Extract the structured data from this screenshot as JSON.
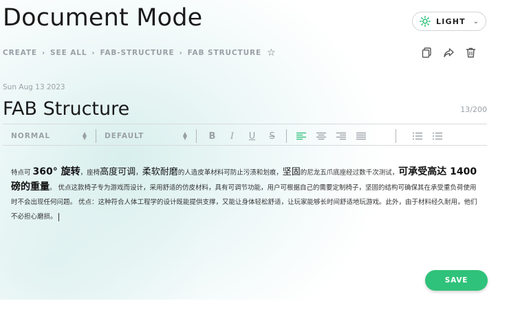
{
  "page": {
    "title": "Document Mode"
  },
  "theme": {
    "label": "LIGHT",
    "accent": "#2fc27a"
  },
  "breadcrumb": {
    "items": [
      "CREATE",
      "SEE ALL",
      "FAB-STRUCTURE",
      "FAB STRUCTURE"
    ]
  },
  "icons": {
    "copy": "copy-icon",
    "share": "share-icon",
    "delete": "trash-icon",
    "favorite": "star-icon",
    "theme": "sun-icon"
  },
  "document": {
    "date": "Sun Aug 13 2023",
    "title": "FAB Structure",
    "counter": "13/200"
  },
  "toolbar": {
    "style_select": "NORMAL",
    "font_select": "DEFAULT",
    "bold": "B",
    "italic": "I",
    "underline": "U",
    "strike": "S"
  },
  "editor": {
    "segments": [
      {
        "text": "特点可 ",
        "style": "normal"
      },
      {
        "text": "360° 旋转",
        "style": "big"
      },
      {
        "text": "，座椅",
        "style": "normal"
      },
      {
        "text": "高度可调",
        "style": "med"
      },
      {
        "text": "，",
        "style": "normal"
      },
      {
        "text": "柔软耐磨",
        "style": "med"
      },
      {
        "text": "的人造皮革材料可防止污渍和划痕，",
        "style": "normal"
      },
      {
        "text": "坚固",
        "style": "med"
      },
      {
        "text": "的尼龙五爪底座经过数千次测试，",
        "style": "normal"
      },
      {
        "text": "可承受高达 1400 磅的重量",
        "style": "big"
      },
      {
        "text": "。 优点这款椅子专为游戏而设计，采用舒适的仿皮材料，具有可调节功能，用户可根据自己的需要定制椅子，坚固的结构可确保其在承受重负荷使用时不会出现任何问题。 优点：这种符合人体工程学的设计既能提供支撑，又能让身体轻松舒适，让玩家能够长时间舒适地玩游戏。此外，由于材料经久耐用，他们不必担心磨损。",
        "style": "normal"
      }
    ]
  },
  "save": {
    "label": "SAVE"
  }
}
